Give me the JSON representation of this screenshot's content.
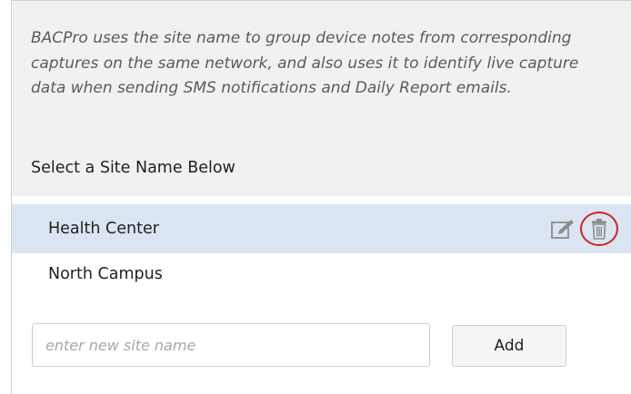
{
  "description": "BACPro uses the site name to group device notes from corresponding captures on the same network, and also uses it to identify live capture data when sending SMS notifications and Daily Report emails.",
  "section_title": "Select a Site Name Below",
  "sites": [
    {
      "label": "Health Center",
      "selected": true
    },
    {
      "label": "North Campus",
      "selected": false
    }
  ],
  "new_site": {
    "value": "",
    "placeholder": "enter new site name",
    "add_label": "Add"
  },
  "icons": {
    "edit": "edit-icon",
    "delete": "trash-icon"
  },
  "colors": {
    "header_bg": "#f1f1f1",
    "selected_row_bg": "#dbe5f2",
    "highlight_circle": "#d0202a",
    "icon_gray": "#8c8c8c"
  }
}
